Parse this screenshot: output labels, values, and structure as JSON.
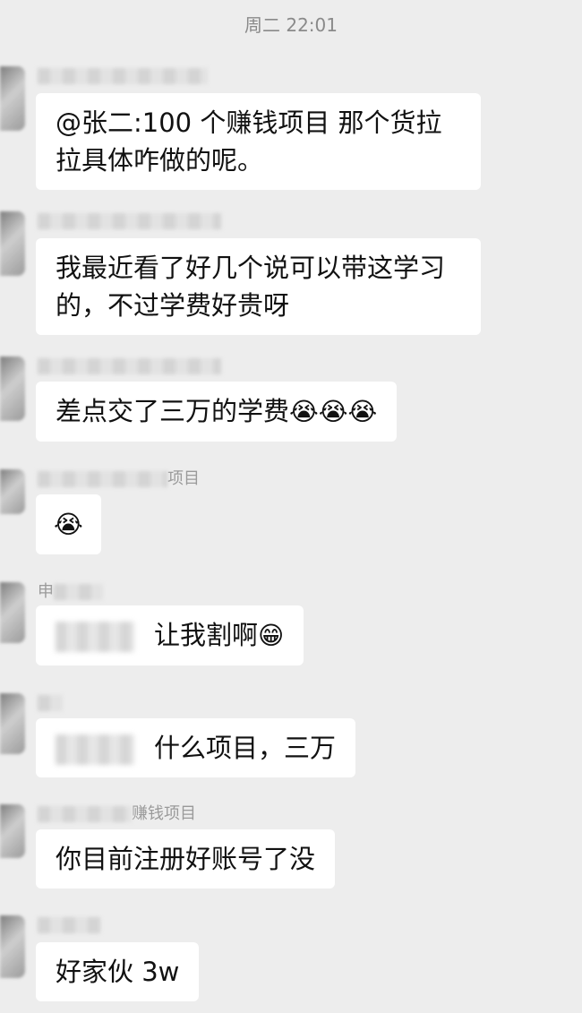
{
  "header": {
    "timestamp": "周二 22:01"
  },
  "messages": [
    {
      "sender_visible": "",
      "text_l1": "@张二:100 个赚钱项目  那个货拉",
      "text_l2": "拉具体咋做的呢。"
    },
    {
      "sender_visible": "",
      "text_l1": "我最近看了好几个说可以带这学习",
      "text_l2": "的，不过学费好贵呀"
    },
    {
      "sender_visible": "",
      "text": "差点交了三万的学费",
      "emojis": "😭😭😭"
    },
    {
      "sender_visible": "项目",
      "emojis": "😭"
    },
    {
      "sender_visible": "申",
      "text": "让我割啊",
      "emojis": "😁"
    },
    {
      "sender_visible": "",
      "text": "什么项目，三万"
    },
    {
      "sender_visible": "赚钱项目",
      "text": "你目前注册好账号了没"
    },
    {
      "sender_visible": "",
      "text": "好家伙 3w"
    }
  ]
}
